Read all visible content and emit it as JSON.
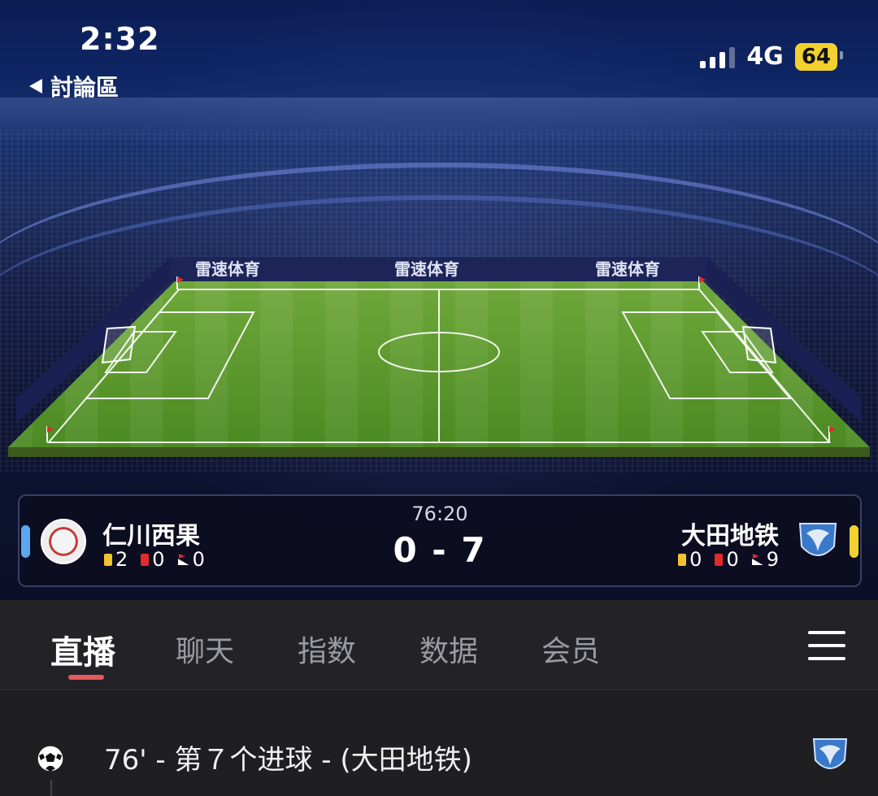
{
  "status_bar": {
    "time": "2:32",
    "back_label": "討論區",
    "network": "4G",
    "battery": "64"
  },
  "pitch": {
    "ad_text": "雷速体育"
  },
  "match": {
    "clock": "76:20",
    "score": "0 - 7",
    "home": {
      "name": "仁川西果",
      "yellow_cards": "2",
      "red_cards": "0",
      "corners": "0",
      "color": "#5aa8f0"
    },
    "away": {
      "name": "大田地铁",
      "yellow_cards": "0",
      "red_cards": "0",
      "corners": "9",
      "color": "#f2d12e"
    }
  },
  "tabs": [
    {
      "label": "直播",
      "active": true
    },
    {
      "label": "聊天",
      "active": false
    },
    {
      "label": "指数",
      "active": false
    },
    {
      "label": "数据",
      "active": false
    },
    {
      "label": "会员",
      "active": false
    }
  ],
  "feed": {
    "events": [
      {
        "text": "76' - 第７个进球 - (大田地铁)",
        "icon": "soccer-ball-icon"
      }
    ]
  },
  "colors": {
    "accent_underline": "#e35a5a",
    "background": "#1f1f22"
  }
}
